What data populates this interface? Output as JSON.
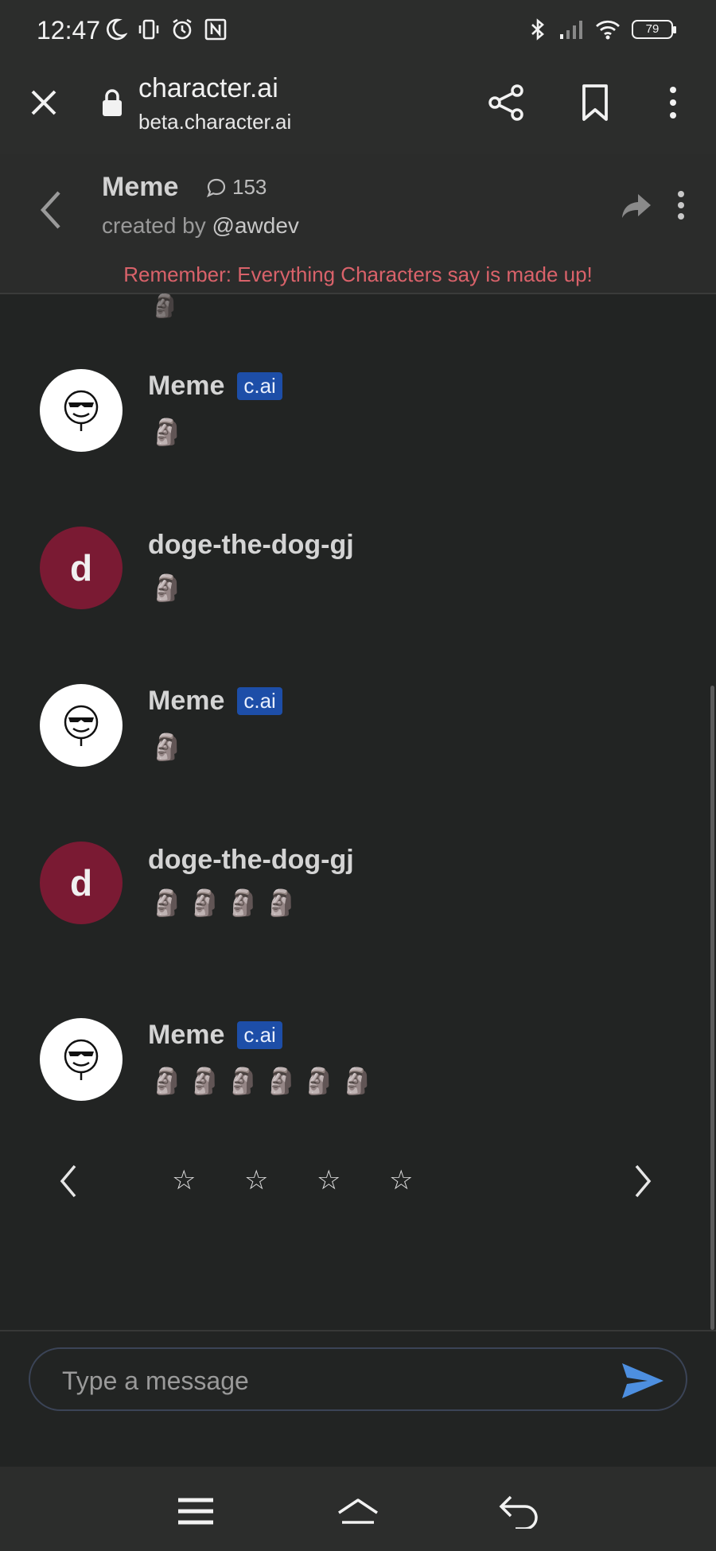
{
  "status_bar": {
    "time": "12:47",
    "battery": "79"
  },
  "browser": {
    "title": "character.ai",
    "url": "beta.character.ai"
  },
  "chat_header": {
    "name": "Meme",
    "message_count": "153",
    "created_by_prefix": "created by ",
    "creator_handle": "@awdev",
    "warning": "Remember: Everything Characters say is made up!"
  },
  "messages": [
    {
      "author": "Meme",
      "badge": "c.ai",
      "type": "bot",
      "text": "🗿"
    },
    {
      "author": "doge-the-dog-gj",
      "type": "user",
      "avatar_letter": "d",
      "text": "🗿"
    },
    {
      "author": "Meme",
      "badge": "c.ai",
      "type": "bot",
      "text": "🗿"
    },
    {
      "author": "doge-the-dog-gj",
      "type": "user",
      "avatar_letter": "d",
      "text": "🗿🗿🗿🗿"
    },
    {
      "author": "Meme",
      "badge": "c.ai",
      "type": "bot",
      "text": "🗿🗿🗿🗿🗿🗿"
    }
  ],
  "previous_message_peek": "🗿",
  "rating": {
    "stars": [
      "☆",
      "☆",
      "☆",
      "☆"
    ]
  },
  "input": {
    "placeholder": "Type a message"
  },
  "colors": {
    "background": "#222423",
    "badge": "#1d4ea8",
    "user_avatar": "#7a1a33",
    "warning": "#d9626a",
    "send_icon": "#4d8fe0"
  }
}
